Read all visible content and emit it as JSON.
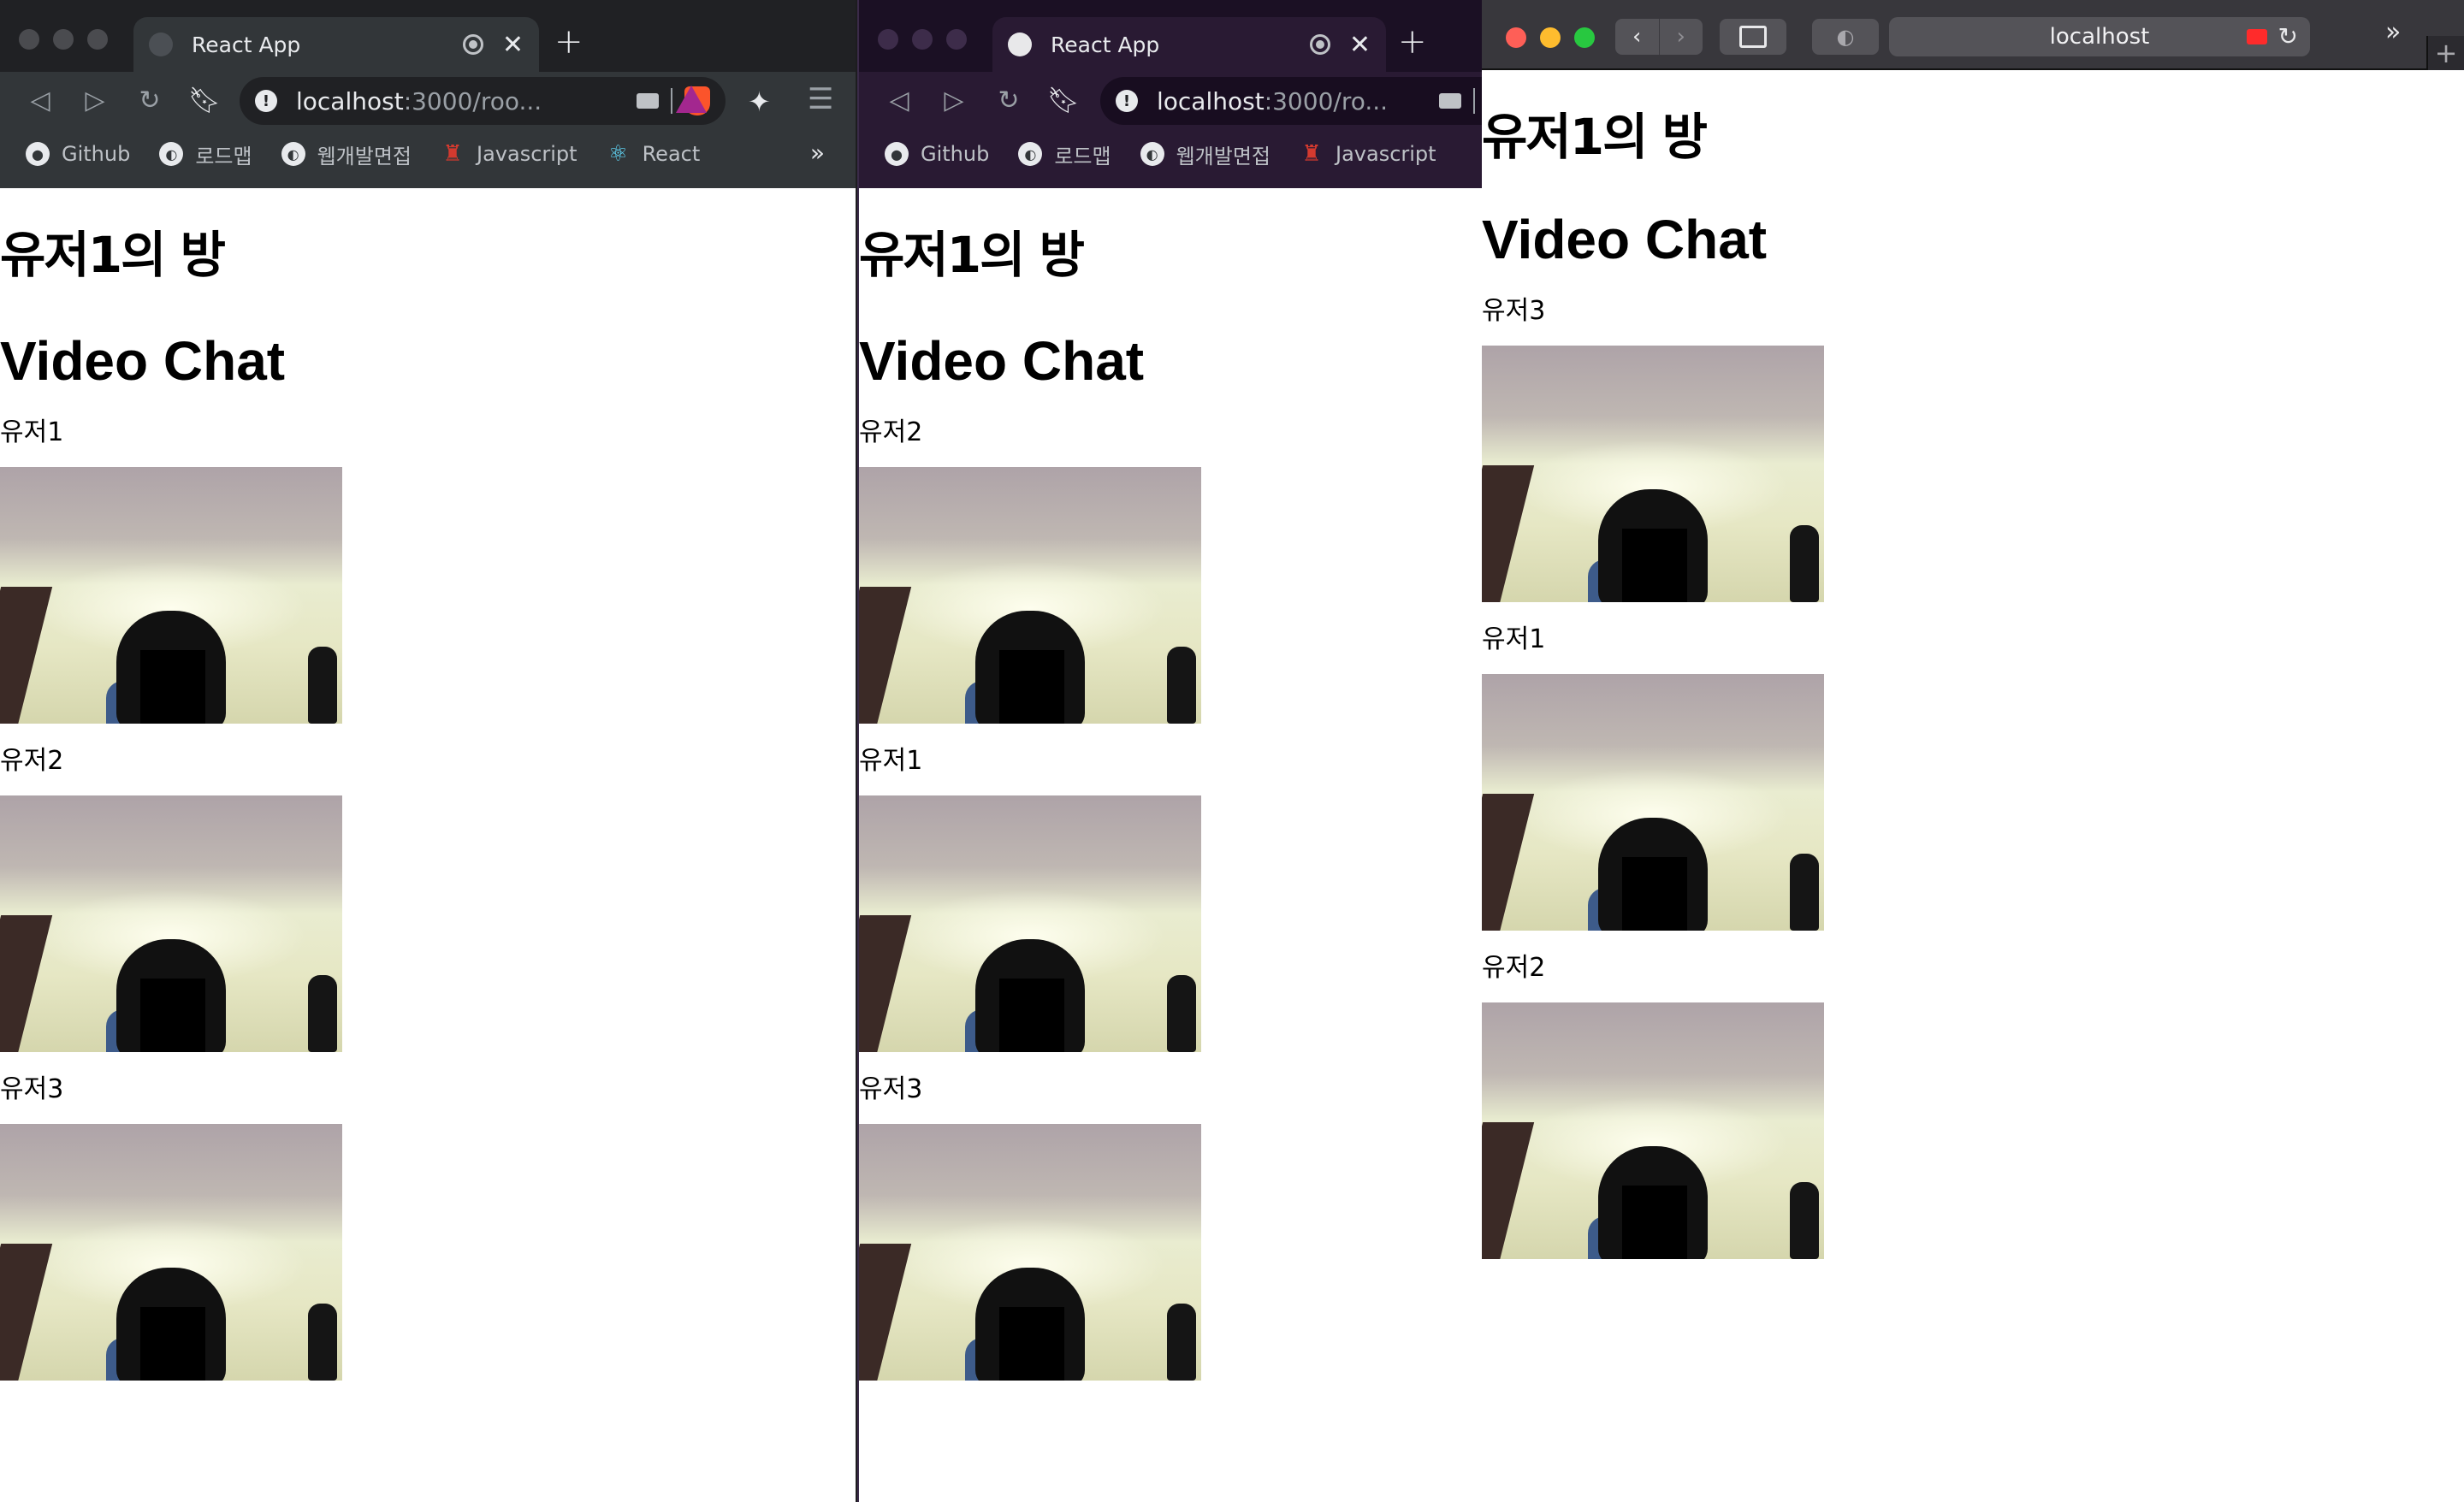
{
  "windows": [
    {
      "tab_title": "React App",
      "url_host": "localhost",
      "url_rest": ":3000/roo...",
      "bookmarks": [
        "Github",
        "로드맵",
        "웹개발면접",
        "Javascript",
        "React"
      ],
      "room_title": "유저1의 방",
      "heading": "Video Chat",
      "users": [
        "유저1",
        "유저2",
        "유저3"
      ]
    },
    {
      "tab_title": "React App",
      "url_host": "localhost",
      "url_rest": ":3000/ro...",
      "bookmarks": [
        "Github",
        "로드맵",
        "웹개발면접",
        "Javascript"
      ],
      "room_title": "유저1의 방",
      "heading": "Video Chat",
      "users": [
        "유저2",
        "유저1",
        "유저3"
      ]
    },
    {
      "url_host": "localhost",
      "room_title": "유저1의 방",
      "heading": "Video Chat",
      "users": [
        "유저3",
        "유저1",
        "유저2"
      ]
    }
  ],
  "icons": {
    "back": "back-arrow-icon",
    "forward": "forward-arrow-icon",
    "reload": "reload-icon",
    "bookmark": "bookmark-icon",
    "extensions": "puzzle-icon",
    "menu": "menu-icon",
    "camera": "camera-icon"
  },
  "colors": {
    "brave_normal_toolbar": "#323639",
    "brave_private_toolbar": "#291a33",
    "safari_toolbar": "#38373c",
    "recording_red": "#ff2b2b"
  }
}
